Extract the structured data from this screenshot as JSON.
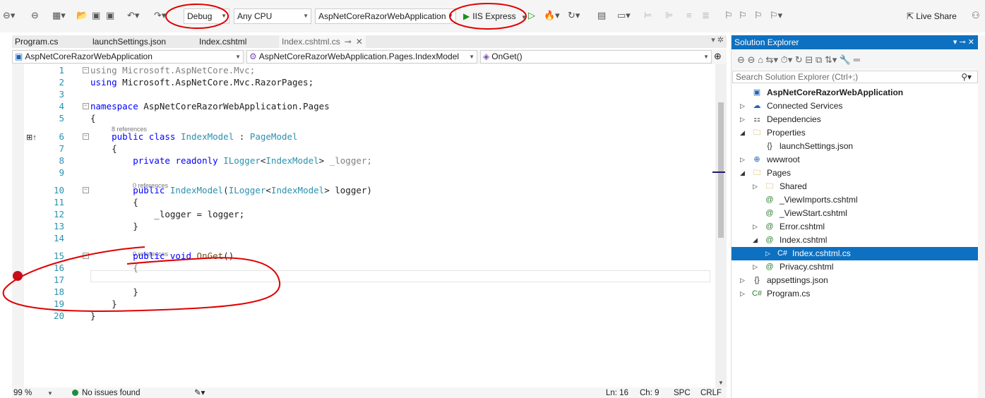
{
  "toolbar": {
    "configuration": "Debug",
    "platform": "Any CPU",
    "startup_project": "AspNetCoreRazorWebApplication",
    "run_target": "IIS Express",
    "live_share": "Live Share"
  },
  "tabs": [
    {
      "label": "Program.cs"
    },
    {
      "label": "launchSettings.json"
    },
    {
      "label": "Index.cshtml"
    },
    {
      "label": "Index.cshtml.cs",
      "active": true
    }
  ],
  "navbar": {
    "project": "AspNetCoreRazorWebApplication",
    "type": "AspNetCoreRazorWebApplication.Pages.IndexModel",
    "member": "OnGet()"
  },
  "code_lens": {
    "class_refs": "8 references",
    "ctor_refs": "0 references",
    "method_refs": "0 references"
  },
  "code_lines": [
    {
      "n": "1",
      "tokens": [
        [
          "gr",
          "using Microsoft.AspNetCore.Mvc;"
        ]
      ]
    },
    {
      "n": "2",
      "tokens": [
        [
          "kw",
          "using"
        ],
        [
          "cl",
          " Microsoft.AspNetCore.Mvc.RazorPages;"
        ]
      ]
    },
    {
      "n": "3",
      "tokens": []
    },
    {
      "n": "4",
      "tokens": [
        [
          "kw",
          "namespace"
        ],
        [
          "cl",
          " AspNetCoreRazorWebApplication.Pages"
        ]
      ]
    },
    {
      "n": "5",
      "tokens": [
        [
          "cl",
          "{"
        ]
      ]
    },
    {
      "n": "6",
      "tokens": [
        [
          "cl",
          "    "
        ],
        [
          "kw",
          "public"
        ],
        [
          "cl",
          " "
        ],
        [
          "kw",
          "class"
        ],
        [
          "cl",
          " "
        ],
        [
          "ty",
          "IndexModel"
        ],
        [
          "cl",
          " : "
        ],
        [
          "ty",
          "PageModel"
        ]
      ]
    },
    {
      "n": "7",
      "tokens": [
        [
          "cl",
          "    {"
        ]
      ]
    },
    {
      "n": "8",
      "tokens": [
        [
          "cl",
          "        "
        ],
        [
          "kw",
          "private"
        ],
        [
          "cl",
          " "
        ],
        [
          "kw",
          "readonly"
        ],
        [
          "cl",
          " "
        ],
        [
          "ty",
          "ILogger"
        ],
        [
          "cl",
          "<"
        ],
        [
          "ty",
          "IndexModel"
        ],
        [
          "cl",
          "> "
        ],
        [
          "gr",
          "_logger;"
        ]
      ]
    },
    {
      "n": "9",
      "tokens": []
    },
    {
      "n": "10",
      "tokens": [
        [
          "cl",
          "        "
        ],
        [
          "kw",
          "public"
        ],
        [
          "cl",
          " "
        ],
        [
          "ty",
          "IndexModel"
        ],
        [
          "cl",
          "("
        ],
        [
          "ty",
          "ILogger"
        ],
        [
          "cl",
          "<"
        ],
        [
          "ty",
          "IndexModel"
        ],
        [
          "cl",
          "> logger)"
        ]
      ]
    },
    {
      "n": "11",
      "tokens": [
        [
          "cl",
          "        {"
        ]
      ]
    },
    {
      "n": "12",
      "tokens": [
        [
          "cl",
          "            _logger = logger;"
        ]
      ]
    },
    {
      "n": "13",
      "tokens": [
        [
          "cl",
          "        }"
        ]
      ]
    },
    {
      "n": "14",
      "tokens": []
    },
    {
      "n": "15",
      "tokens": [
        [
          "cl",
          "        "
        ],
        [
          "kw",
          "public"
        ],
        [
          "cl",
          " "
        ],
        [
          "kw",
          "void"
        ],
        [
          "cl",
          " "
        ],
        [
          "mt",
          "OnGet"
        ],
        [
          "cl",
          "()"
        ]
      ]
    },
    {
      "n": "16",
      "tokens": [
        [
          "gr",
          "        {"
        ]
      ]
    },
    {
      "n": "17",
      "tokens": []
    },
    {
      "n": "18",
      "tokens": [
        [
          "cl",
          "        }"
        ]
      ]
    },
    {
      "n": "19",
      "tokens": [
        [
          "cl",
          "    }"
        ]
      ]
    },
    {
      "n": "20",
      "tokens": [
        [
          "cl",
          "}"
        ]
      ]
    }
  ],
  "status": {
    "zoom": "99 %",
    "issues": "No issues found",
    "line": "Ln: 16",
    "col": "Ch: 9",
    "spc": "SPC",
    "eol": "CRLF"
  },
  "solution_explorer": {
    "title": "Solution Explorer",
    "search_placeholder": "Search Solution Explorer (Ctrl+;)",
    "items": [
      {
        "label": "AspNetCoreRazorWebApplication",
        "icon": "csharp-project-icon",
        "glyph": "▣",
        "color": "#1e64b4",
        "depth": 0,
        "expander": "",
        "bold": true
      },
      {
        "label": "Connected Services",
        "icon": "connected-services-icon",
        "glyph": "☁",
        "color": "#1e64b4",
        "depth": 0,
        "expander": "▷"
      },
      {
        "label": "Dependencies",
        "icon": "dependencies-icon",
        "glyph": "⚏",
        "color": "#333333",
        "depth": 0,
        "expander": "▷"
      },
      {
        "label": "Properties",
        "icon": "properties-folder-icon",
        "glyph": "🗀",
        "color": "#b58b00",
        "depth": 0,
        "expander": "◢"
      },
      {
        "label": "launchSettings.json",
        "icon": "json-file-icon",
        "glyph": "{}",
        "color": "#333333",
        "depth": 1,
        "expander": ""
      },
      {
        "label": "wwwroot",
        "icon": "globe-icon",
        "glyph": "⊕",
        "color": "#1e64b4",
        "depth": 0,
        "expander": "▷"
      },
      {
        "label": "Pages",
        "icon": "folder-icon",
        "glyph": "🗀",
        "color": "#b58b00",
        "depth": 0,
        "expander": "◢"
      },
      {
        "label": "Shared",
        "icon": "folder-icon",
        "glyph": "🗀",
        "color": "#b58b00",
        "depth": 1,
        "expander": "▷"
      },
      {
        "label": "_ViewImports.cshtml",
        "icon": "razor-file-icon",
        "glyph": "@",
        "color": "#2d7d2d",
        "depth": 1,
        "expander": ""
      },
      {
        "label": "_ViewStart.cshtml",
        "icon": "razor-file-icon",
        "glyph": "@",
        "color": "#2d7d2d",
        "depth": 1,
        "expander": ""
      },
      {
        "label": "Error.cshtml",
        "icon": "razor-file-icon",
        "glyph": "@",
        "color": "#2d7d2d",
        "depth": 1,
        "expander": "▷"
      },
      {
        "label": "Index.cshtml",
        "icon": "razor-file-icon",
        "glyph": "@",
        "color": "#2d7d2d",
        "depth": 1,
        "expander": "◢"
      },
      {
        "label": "Index.cshtml.cs",
        "icon": "csharp-file-icon",
        "glyph": "C#",
        "color": "#ffffff",
        "depth": 2,
        "expander": "▷",
        "selected": true
      },
      {
        "label": "Privacy.cshtml",
        "icon": "razor-file-icon",
        "glyph": "@",
        "color": "#2d7d2d",
        "depth": 1,
        "expander": "▷"
      },
      {
        "label": "appsettings.json",
        "icon": "json-file-icon",
        "glyph": "{}",
        "color": "#333333",
        "depth": 0,
        "expander": "▷"
      },
      {
        "label": "Program.cs",
        "icon": "csharp-file-icon",
        "glyph": "C#",
        "color": "#2d7d2d",
        "depth": 0,
        "expander": "▷"
      }
    ]
  },
  "colors": {
    "accent": "#0e70c0",
    "breakpoint": "#c50f1f",
    "annotation": "#e00000"
  }
}
